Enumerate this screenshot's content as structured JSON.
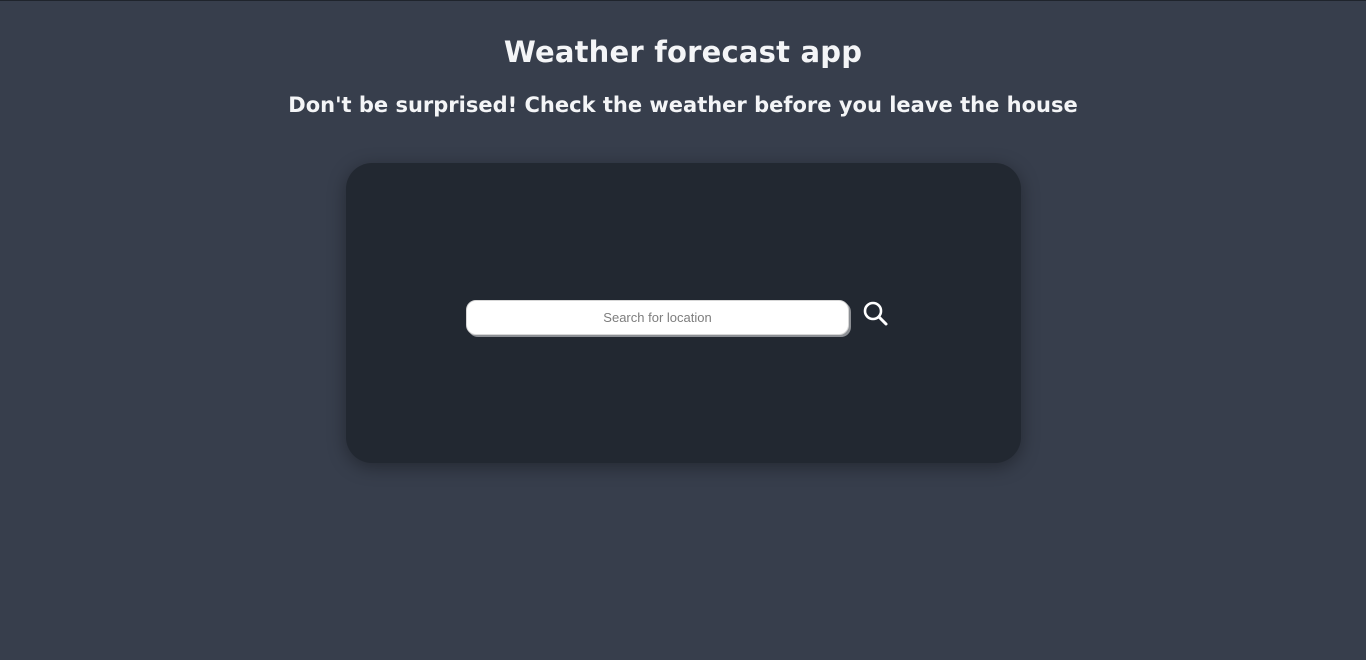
{
  "header": {
    "title": "Weather forecast app",
    "subtitle": "Don't be surprised! Check the weather before you leave the house"
  },
  "search": {
    "placeholder": "Search for location",
    "value": "",
    "button_icon": "search-icon"
  },
  "colors": {
    "page_background": "#373e4c",
    "card_background": "#222831",
    "text": "#f4f5f7",
    "icon": "#ffffff"
  }
}
